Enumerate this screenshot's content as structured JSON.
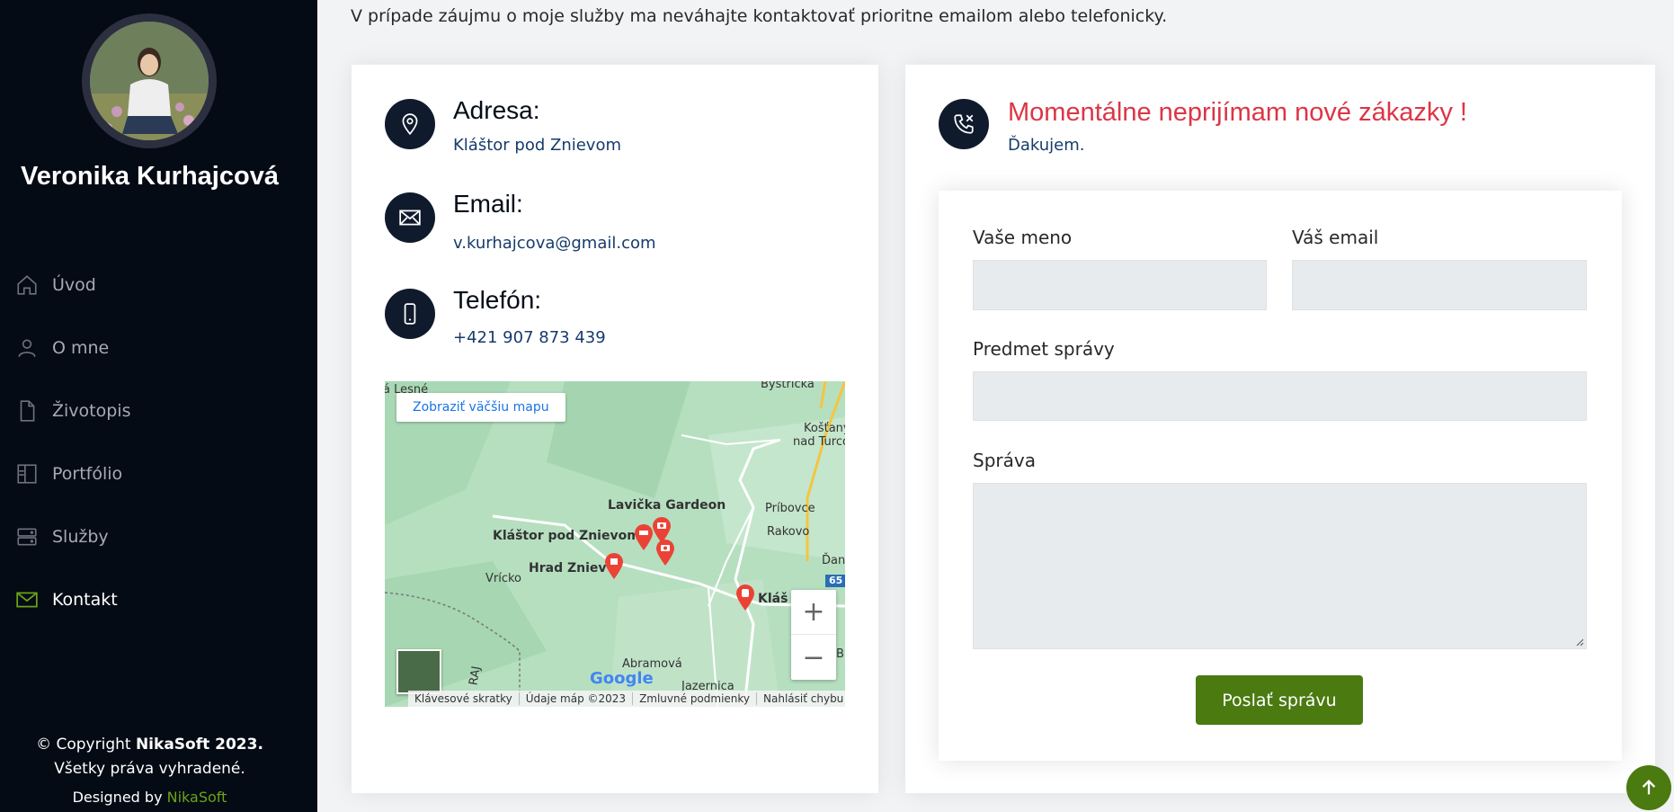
{
  "sidebar": {
    "name": "Veronika Kurhajcová",
    "nav": [
      {
        "label": "Úvod",
        "icon": "house-icon"
      },
      {
        "label": "O mne",
        "icon": "person-icon"
      },
      {
        "label": "Životopis",
        "icon": "file-icon"
      },
      {
        "label": "Portfólio",
        "icon": "layout-icon"
      },
      {
        "label": "Služby",
        "icon": "server-icon"
      },
      {
        "label": "Kontakt",
        "icon": "envelope-icon",
        "active": true
      }
    ],
    "copyright_prefix": "© Copyright ",
    "copyright_brand": "NikaSoft 2023.",
    "rights": "Všetky práva vyhradené.",
    "designed_prefix": "Designed by ",
    "designed_brand": "NikaSoft"
  },
  "intro": "V prípade záujmu o moje služby ma neváhajte kontaktovať prioritne emailom alebo telefonicky.",
  "contact": {
    "address_title": "Adresa:",
    "address_value": "Kláštor pod Znievom",
    "email_title": "Email:",
    "email_value": "v.kurhajcova@gmail.com",
    "phone_title": "Telefón:",
    "phone_value": "+421 907 873 439"
  },
  "map": {
    "larger_map_button": "Zobraziť väčšiu mapu",
    "labels": {
      "lavicka": "Lavička Gardeon",
      "klastor": "Kláštor pod Znievom",
      "hrad": "Hrad Zniev",
      "vricko": "Vrícko",
      "pribovce": "Príbovce",
      "rakovo": "Rakovo",
      "abramova": "Abramová",
      "jazernica": "Jazernica",
      "bystricka": "Bystrička",
      "kostany": "Košťany",
      "nad_turcom": "nad Turcom",
      "klas": "Kláš",
      "dan": "Ďan",
      "raj": "RAJ",
      "lesne": "á Lesné",
      "road_65": "65",
      "b": "B"
    },
    "google_logo": "Google",
    "footer": [
      "Klávesové skratky",
      "Údaje máp ©2023",
      "Zmluvné podmienky",
      "Nahlásiť chybu mapy"
    ],
    "zoom_in": "+",
    "zoom_out": "−"
  },
  "notice": {
    "title": "Momentálne neprijímam nové zákazky !",
    "subtitle": "Ďakujem."
  },
  "form": {
    "name_label": "Vaše meno",
    "email_label": "Váš email",
    "subject_label": "Predmet správy",
    "message_label": "Správa",
    "send_button": "Poslať správu"
  },
  "colors": {
    "sidebar_bg": "#040b14",
    "accent_green": "#4a7a10",
    "notice_red": "#dc3545",
    "icon_circle": "#0f1b2d"
  }
}
